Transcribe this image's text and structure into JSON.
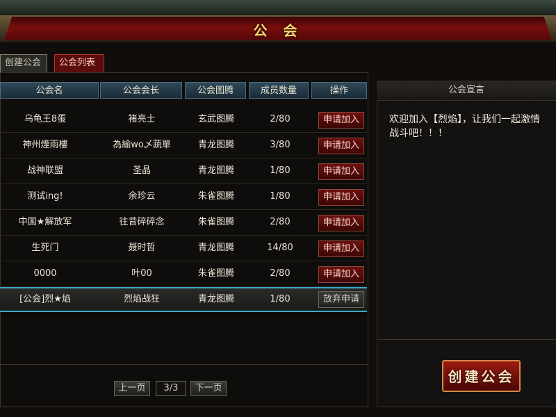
{
  "window": {
    "title": "公 会"
  },
  "tabs": {
    "create": "创建公会",
    "list": "公会列表"
  },
  "columns": [
    "公会名",
    "公会会长",
    "公会图腾",
    "成员数量",
    "操作"
  ],
  "guilds": [
    {
      "name": "乌龟王8蛋",
      "leader": "褚亮士",
      "totem": "玄武图腾",
      "members": "2/80",
      "action": "申请加入"
    },
    {
      "name": "神州煙雨樓",
      "leader": "為緰wo乄蔬單",
      "totem": "青龙图腾",
      "members": "3/80",
      "action": "申请加入"
    },
    {
      "name": "战神联盟",
      "leader": "圣晶",
      "totem": "青龙图腾",
      "members": "1/80",
      "action": "申请加入"
    },
    {
      "name": "测试ing!",
      "leader": "余珍云",
      "totem": "朱雀图腾",
      "members": "1/80",
      "action": "申请加入"
    },
    {
      "name": "中国★解放军",
      "leader": "往昔碎碎念",
      "totem": "朱雀图腾",
      "members": "2/80",
      "action": "申请加入"
    },
    {
      "name": "生死门",
      "leader": "聂时哲",
      "totem": "青龙图腾",
      "members": "14/80",
      "action": "申请加入"
    },
    {
      "name": "0000",
      "leader": "叶00",
      "totem": "朱雀图腾",
      "members": "2/80",
      "action": "申请加入"
    },
    {
      "name": "[公会]烈★焰",
      "leader": "烈焰战狂",
      "totem": "青龙图腾",
      "members": "1/80",
      "action": "放弃申请"
    }
  ],
  "pager": {
    "prev": "上一页",
    "page": "3/3",
    "next": "下一页"
  },
  "declaration": {
    "title": "公会宣言",
    "line1": "欢迎加入【烈焰】，让我们一起激情",
    "line2": "战斗吧！！！"
  },
  "create_button": "创建公会",
  "colors": {
    "accent_red": "#7a0d0d",
    "title_gold": "#ffd86a",
    "selection": "#3aa9c7"
  }
}
